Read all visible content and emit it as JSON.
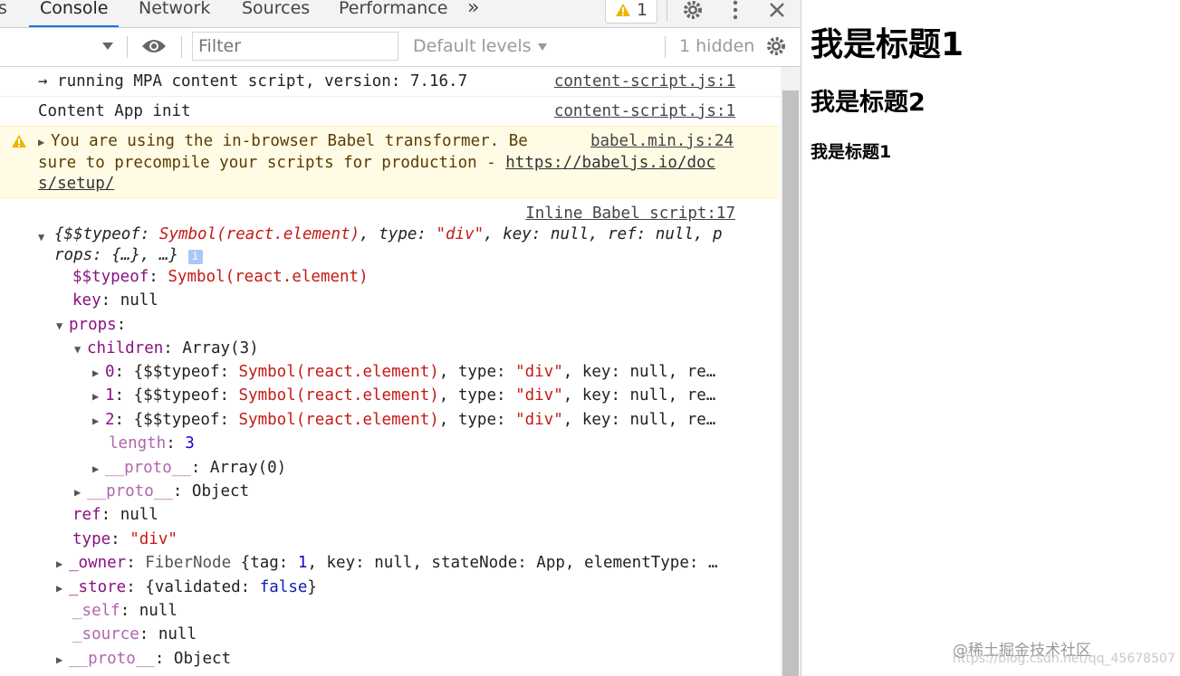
{
  "devtools": {
    "tabs": [
      "Console",
      "Network",
      "Sources",
      "Performance"
    ],
    "more_tabs": "»",
    "warning_count": "1",
    "colors": {
      "accent": "#1a73e8",
      "warning_bg": "#fffbe5"
    }
  },
  "toolbar": {
    "filter_placeholder": "Filter",
    "levels_label": "Default levels",
    "hidden_label": "1 hidden"
  },
  "console": {
    "msg1": {
      "text": "→ running MPA content script, version: 7.16.7",
      "source": "content-script.js:1"
    },
    "msg2": {
      "text": "Content App init",
      "source": "content-script.js:1"
    },
    "warning": {
      "line1": "You are using the in-browser Babel transformer. Be",
      "line2_prefix": "sure to precompile your scripts for production - ",
      "link_part1": "https://babeljs.io/doc",
      "link_part2": "s/setup/",
      "source": "babel.min.js:24"
    },
    "log": {
      "source": "Inline Babel script:17",
      "summary1_prefix": "{$$typeof: ",
      "summary1_sym": "Symbol(react.element)",
      "summary1_mid": ", type: ",
      "summary1_str": "\"div\"",
      "summary1_rest": ", key: null, ref: null, p",
      "summary2": "rops: {…}, …}",
      "info_badge": "i",
      "typeof_key": "$$typeof",
      "typeof_val": "Symbol(react.element)",
      "key_key": "key",
      "key_val": "null",
      "props_key": "props",
      "children_key": "children",
      "children_val": "Array(3)",
      "children": [
        {
          "idx": "0",
          "rest": ", key: null, re…"
        },
        {
          "idx": "1",
          "rest": ", key: null, re…"
        },
        {
          "idx": "2",
          "rest": ", key: null, re…"
        }
      ],
      "child_prefix": ": {$$typeof: ",
      "child_sym": "Symbol(react.element)",
      "child_mid": ", type: ",
      "child_str": "\"div\"",
      "length_key": "length",
      "length_val": "3",
      "proto_key": "__proto__",
      "proto_array_val": "Array(0)",
      "proto_object_val": "Object",
      "ref_key": "ref",
      "ref_val": "null",
      "type_key": "type",
      "type_val": "\"div\"",
      "owner_key": "_owner",
      "owner_type": "FiberNode",
      "owner_prefix": " {tag: ",
      "owner_num": "1",
      "owner_rest": ", key: null, stateNode: App, elementType: …",
      "store_key": "_store",
      "store_prefix": "{validated: ",
      "store_val": "false",
      "store_suffix": "}",
      "self_key": "_self",
      "self_val": "null",
      "source_key": "_source",
      "source_val": "null"
    }
  },
  "page": {
    "h1": "我是标题1",
    "h2": "我是标题2",
    "h3": "我是标题1"
  },
  "watermark": {
    "text": "@稀土掘金技术社区",
    "url": "https://blog.csdn.net/qq_45678507"
  }
}
